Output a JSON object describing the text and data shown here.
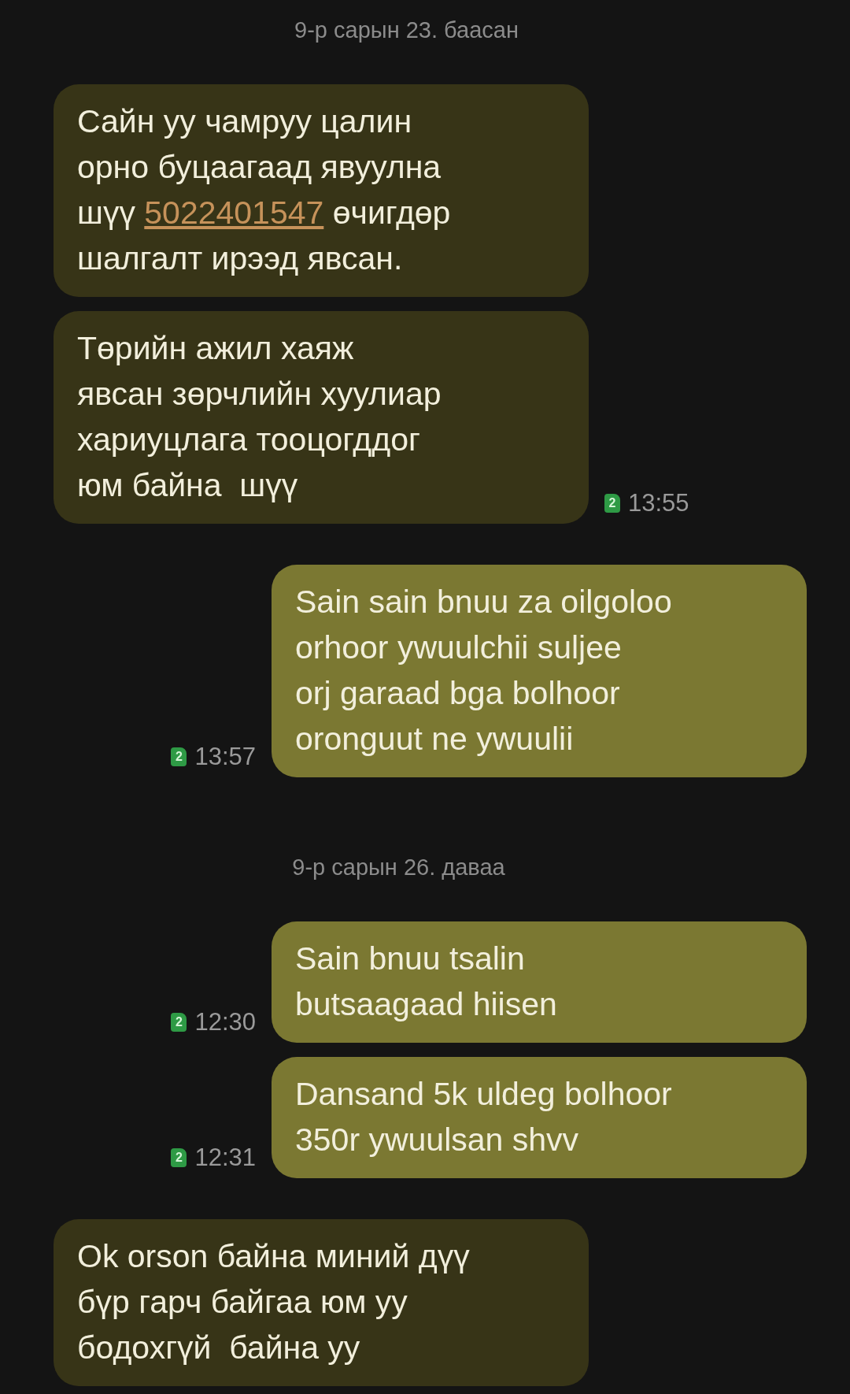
{
  "conversation": [
    {
      "kind": "date",
      "text": "9-р сарын 23. баасан"
    },
    {
      "kind": "incoming",
      "parts": [
        {
          "kind": "text",
          "text": "Сайн уу чамруу цалин\nорно буцаагаад явуулна\nшүү "
        },
        {
          "kind": "link",
          "text": "5022401547"
        },
        {
          "kind": "text",
          "text": " өчигдөр\nшалгалт ирээд явсан."
        }
      ]
    },
    {
      "kind": "incoming",
      "parts": [
        {
          "kind": "text",
          "text": "Төрийн ажил хаяж\nявсан зөрчлийн хуулиар\nхариуцлага тооцогддог\nюм байна  шүү"
        }
      ],
      "sim": "2",
      "time": "13:55"
    },
    {
      "kind": "outgoing",
      "parts": [
        {
          "kind": "text",
          "text": "Sain sain bnuu za oilgoloo\norhoor ywuulchii suljee\norj garaad bga bolhoor\noronguut ne ywuulii"
        }
      ],
      "sim": "2",
      "time": "13:57"
    },
    {
      "kind": "date",
      "text": "9-р сарын 26. даваа"
    },
    {
      "kind": "outgoing",
      "parts": [
        {
          "kind": "text",
          "text": "Sain bnuu tsalin\nbutsaagaad hiisen"
        }
      ],
      "sim": "2",
      "time": "12:30"
    },
    {
      "kind": "outgoing",
      "parts": [
        {
          "kind": "text",
          "text": "Dansand 5k uldeg bolhoor\n350r ywuulsan shvv"
        }
      ],
      "sim": "2",
      "time": "12:31"
    },
    {
      "kind": "incoming",
      "parts": [
        {
          "kind": "text",
          "text": "Ok orson байна миний дүү\nбүр гарч байгаа юм уу\nбодохгүй  байна уу"
        }
      ]
    }
  ]
}
